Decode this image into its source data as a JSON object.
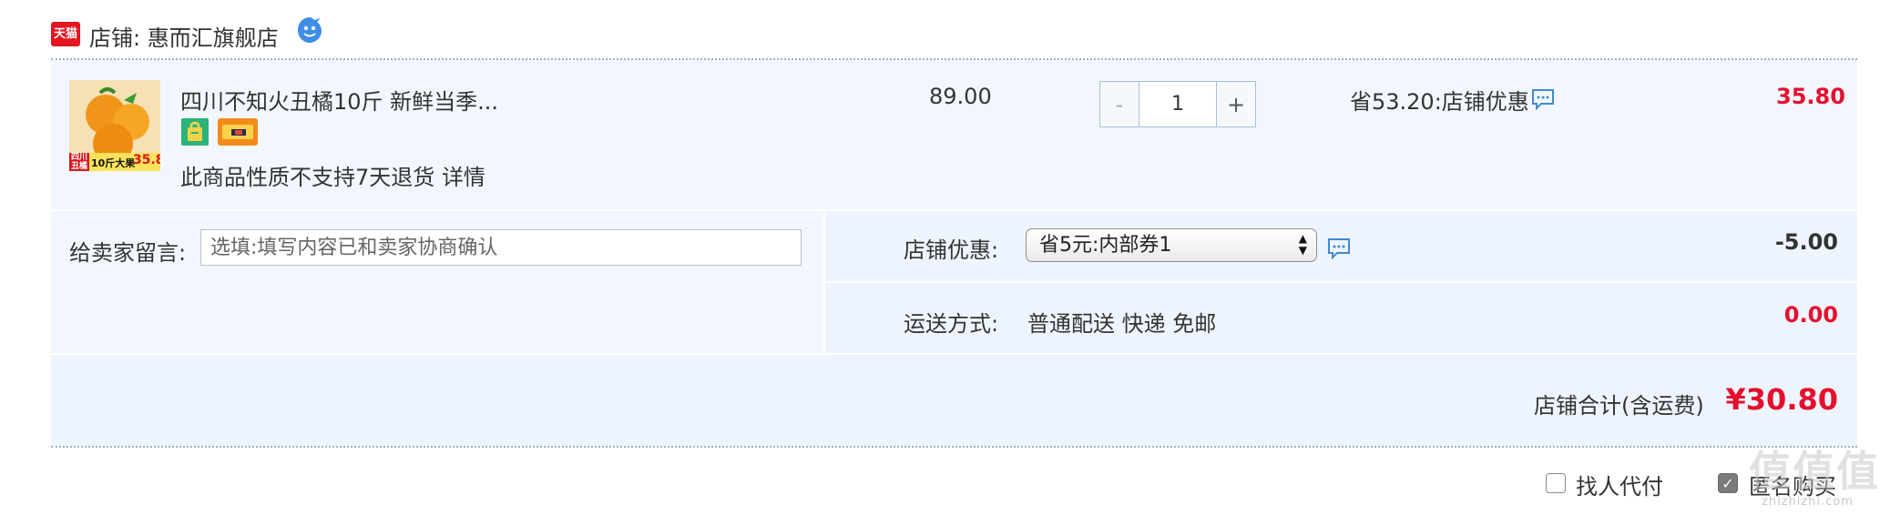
{
  "shop": {
    "logo_text": "天猫",
    "label": "店铺: 惠而汇旗舰店"
  },
  "item": {
    "title": "四川不知火丑橘10斤 新鲜当季...",
    "image_caption_region": "四川 丑橘",
    "image_caption_spec": "10斤大果",
    "image_caption_price": "35.8",
    "no_return_text": "此商品性质不支持7天退货",
    "detail_link": "详情",
    "unit_price": "89.00",
    "quantity": "1",
    "qty_minus": "-",
    "qty_plus": "+",
    "promo_text": "省53.20:店铺优惠",
    "subtotal": "35.80"
  },
  "message": {
    "label": "给卖家留言:",
    "placeholder": "选填:填写内容已和卖家协商确认"
  },
  "coupon": {
    "label": "店铺优惠:",
    "selected": "省5元:内部券1",
    "amount": "-5.00"
  },
  "shipping": {
    "label": "运送方式:",
    "method": "普通配送 快递 免邮",
    "fee": "0.00"
  },
  "total": {
    "label": "店铺合计(含运费)",
    "amount": "¥30.80"
  },
  "options": {
    "pay_for_me": {
      "label": "找人代付",
      "checked": false
    },
    "anonymous": {
      "label": "匿名购买",
      "checked": true
    }
  },
  "watermark": {
    "glyph": "值",
    "text": "zhizhizhi.com"
  },
  "colors": {
    "price_red": "#e4102e",
    "tmall_red": "#e4151f",
    "row_bg": "#f2f7ff",
    "section_bg": "#eef4fd",
    "chat_blue": "#3f8ad6"
  }
}
